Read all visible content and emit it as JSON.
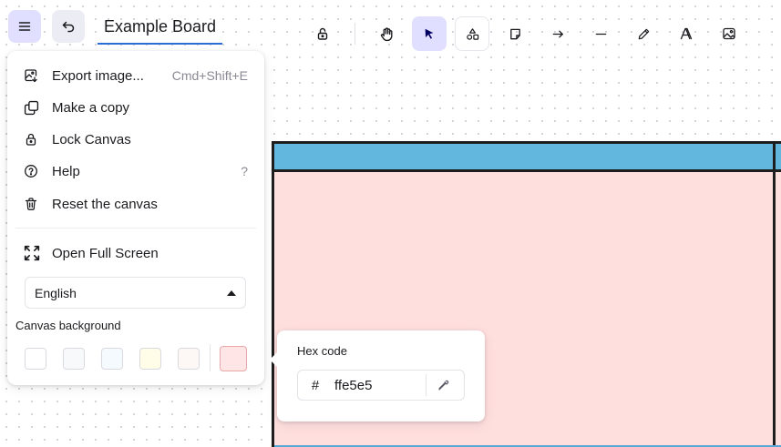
{
  "header": {
    "menu_icon": "hamburger-icon",
    "undo_icon": "undo-icon",
    "board_title": "Example Board"
  },
  "toolbar": {
    "tools": [
      {
        "name": "lock",
        "icon": "lock-open-icon"
      },
      {
        "name": "hand",
        "icon": "hand-icon"
      },
      {
        "name": "selection",
        "icon": "cursor-arrow-icon",
        "active": true
      },
      {
        "name": "shapes",
        "icon": "shapes-icon"
      },
      {
        "name": "sticky-note",
        "icon": "sticky-note-icon"
      },
      {
        "name": "arrow",
        "icon": "arrow-right-icon"
      },
      {
        "name": "line",
        "icon": "line-icon"
      },
      {
        "name": "pencil",
        "icon": "pencil-icon"
      },
      {
        "name": "text",
        "icon": "text-icon"
      },
      {
        "name": "image",
        "icon": "image-icon"
      }
    ],
    "active_color": "#e0dfff"
  },
  "main_menu": {
    "items": [
      {
        "label": "Export image...",
        "shortcut": "Cmd+Shift+E",
        "icon": "export-image-icon"
      },
      {
        "label": "Make a copy",
        "shortcut": "",
        "icon": "copy-icon"
      },
      {
        "label": "Lock Canvas",
        "shortcut": "",
        "icon": "lock-icon"
      },
      {
        "label": "Help",
        "shortcut": "?",
        "icon": "help-circle-icon"
      },
      {
        "label": "Reset the canvas",
        "shortcut": "",
        "icon": "trash-icon"
      }
    ],
    "fullscreen": {
      "label": "Open Full Screen",
      "icon": "fullscreen-icon"
    },
    "language": {
      "selected": "English"
    },
    "canvas_background": {
      "label": "Canvas background",
      "swatches": [
        "#ffffff",
        "#f8f9fa",
        "#f5faff",
        "#fffce8",
        "#fdf8f6"
      ],
      "selected": "#ffe5e5"
    }
  },
  "hex_popover": {
    "label": "Hex code",
    "hash": "#",
    "value": "ffe5e5",
    "eyedropper_icon": "eyedropper-icon"
  },
  "canvas": {
    "frame_fill": "#ffdede",
    "header_fill": "#62b7df",
    "stroke": "#1e1e1e"
  }
}
